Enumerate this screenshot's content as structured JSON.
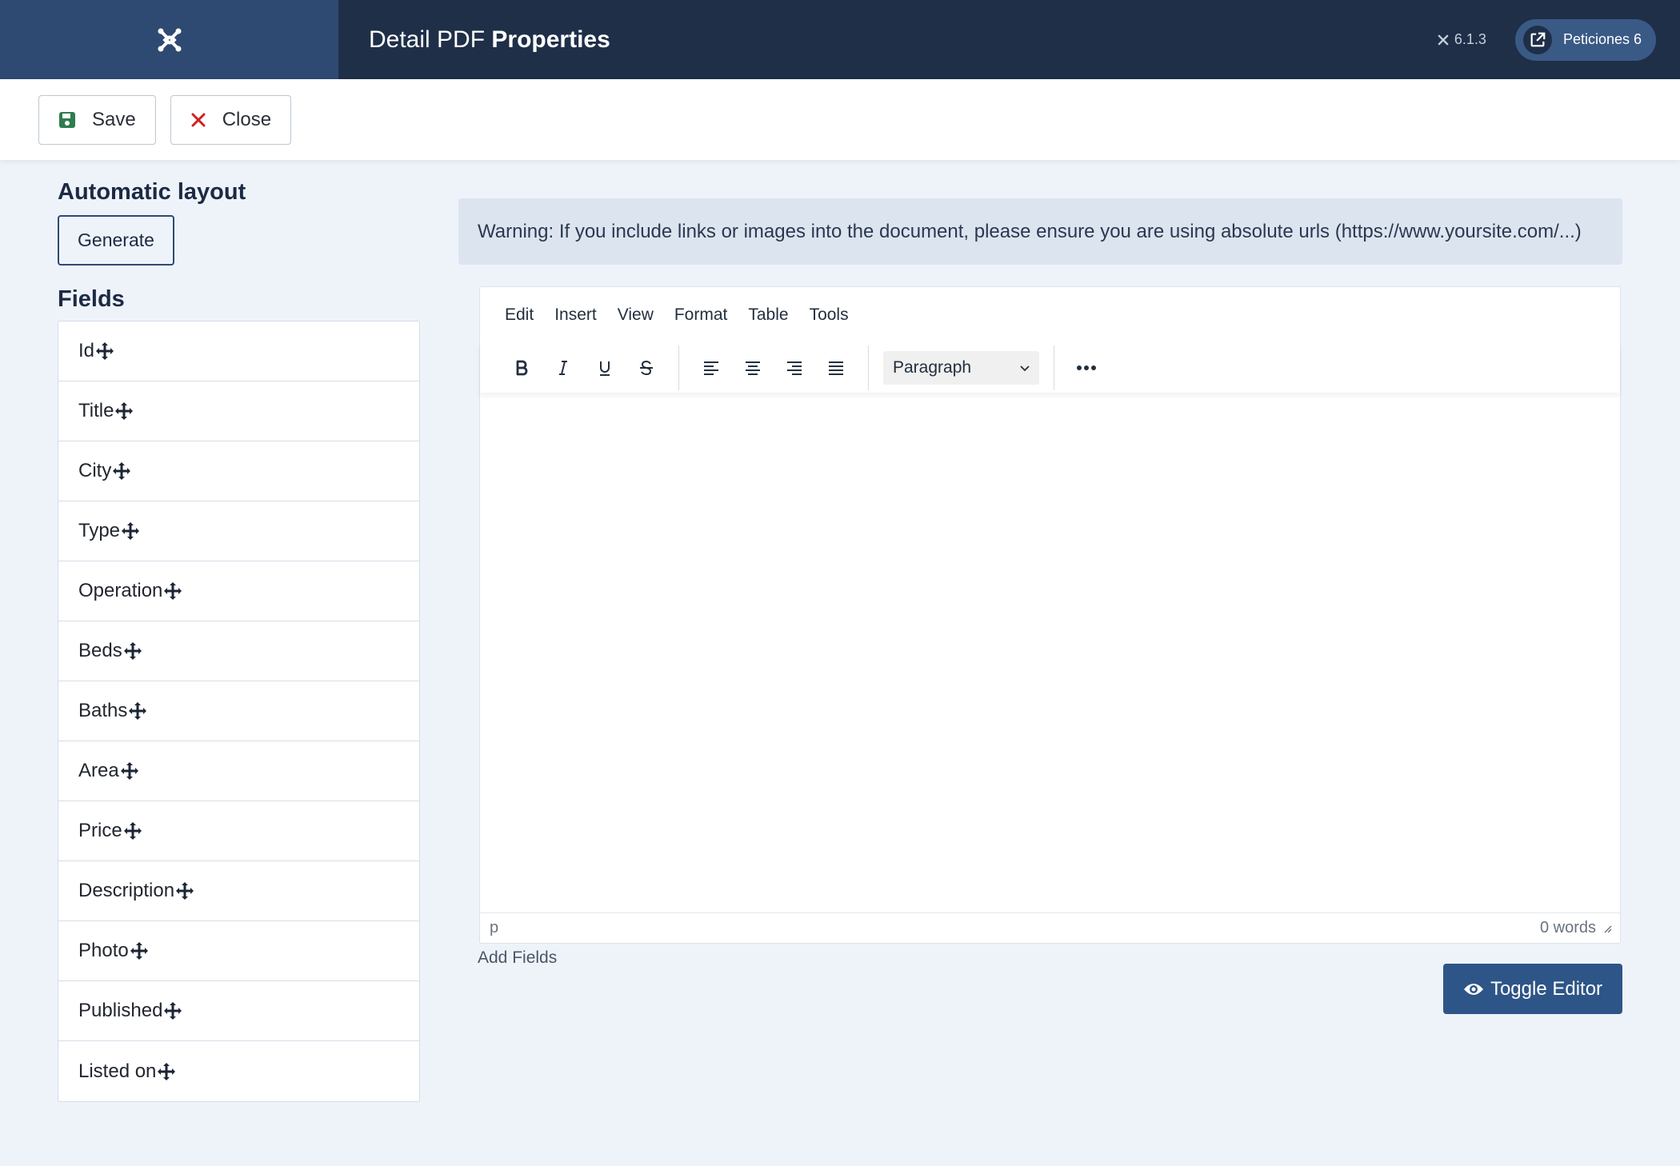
{
  "header": {
    "title_prefix": "Detail PDF",
    "title_bold": "Properties",
    "version": "6.1.3",
    "peticiones_label": "Peticiones 6",
    "colors": {
      "bar": "#1f2f48",
      "brand": "#2f4a72",
      "pill": "#3a5a86"
    }
  },
  "toolbar": {
    "save_label": "Save",
    "close_label": "Close",
    "save_icon": "floppy-icon",
    "close_icon": "x-icon"
  },
  "left": {
    "layout_title": "Automatic layout",
    "generate_label": "Generate",
    "fields_title": "Fields",
    "fields": [
      "Id",
      "Title",
      "City",
      "Type",
      "Operation",
      "Beds",
      "Baths",
      "Area",
      "Price",
      "Description",
      "Photo",
      "Published",
      "Listed on"
    ]
  },
  "warning": {
    "text": "Warning: If you include links or images into the document, please ensure you are using absolute urls (https://www.yoursite.com/...)"
  },
  "editor": {
    "menus": [
      "Edit",
      "Insert",
      "View",
      "Format",
      "Table",
      "Tools"
    ],
    "block_format": "Paragraph",
    "path": "p",
    "word_count": "0 words"
  },
  "add_fields_label": "Add Fields",
  "toggle_editor_label": "Toggle Editor"
}
